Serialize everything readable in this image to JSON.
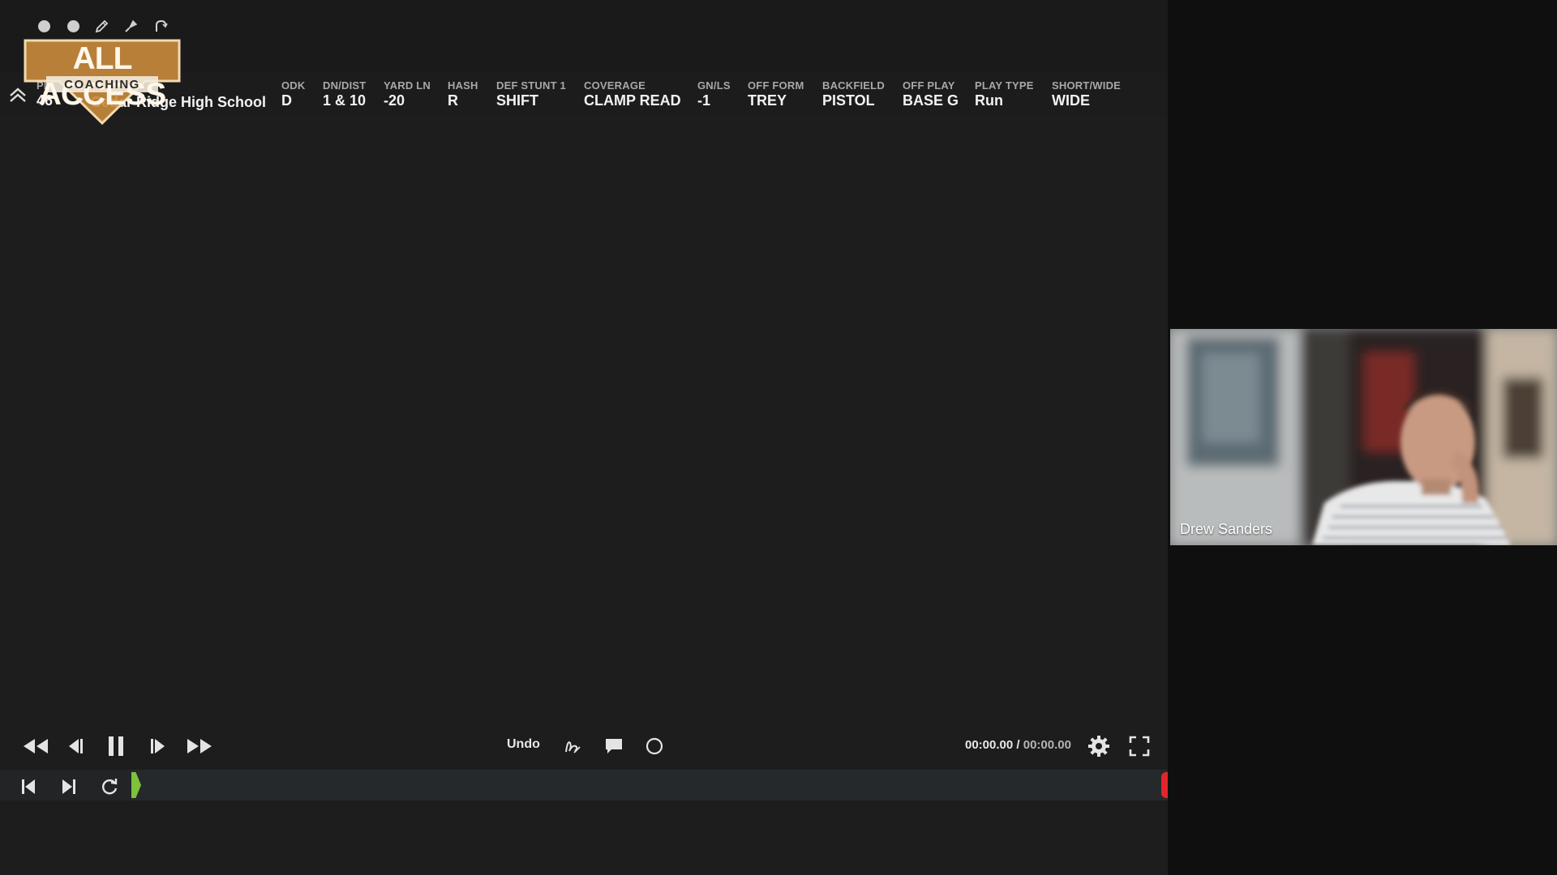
{
  "logo": {
    "line1": "ALL ACCESS",
    "line2": "COACHING"
  },
  "colors": {
    "logo_orange": "#c98b3c",
    "start_marker": "#7dc23b",
    "end_marker": "#e0262a"
  },
  "tools": [
    {
      "icon": "circle-icon"
    },
    {
      "icon": "circle-icon"
    },
    {
      "icon": "pencil-icon"
    },
    {
      "icon": "marker-icon"
    },
    {
      "icon": "arc-icon"
    }
  ],
  "play_info": {
    "team": "Cedar Ridge High School",
    "fields": [
      {
        "label": "PL",
        "value": "46"
      },
      {
        "label": "ODK",
        "value": "D"
      },
      {
        "label": "DN/DIST",
        "value": "1 & 10"
      },
      {
        "label": "YARD LN",
        "value": "-20"
      },
      {
        "label": "HASH",
        "value": "R"
      },
      {
        "label": "DEF STUNT 1",
        "value": "SHIFT"
      },
      {
        "label": "COVERAGE",
        "value": "CLAMP READ"
      },
      {
        "label": "GN/LS",
        "value": "-1"
      },
      {
        "label": "OFF FORM",
        "value": "TREY"
      },
      {
        "label": "BACKFIELD",
        "value": "PISTOL"
      },
      {
        "label": "OFF PLAY",
        "value": "BASE G"
      },
      {
        "label": "PLAY TYPE",
        "value": "Run"
      },
      {
        "label": "SHORT/WIDE",
        "value": "WIDE"
      }
    ]
  },
  "controls": {
    "undo_label": "Undo",
    "time_current": "00:00.00",
    "time_separator": " / ",
    "time_total": "00:00.00"
  },
  "video": {
    "participant_name": "Drew Sanders"
  }
}
